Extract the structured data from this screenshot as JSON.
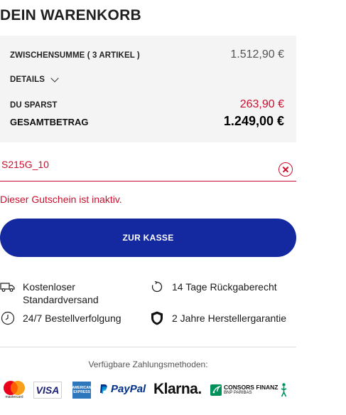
{
  "cart": {
    "title": "DEIN WARENKORB"
  },
  "summary": {
    "subtotal_label": "ZWISCHENSUMME ( 3 ARTIKEL )",
    "subtotal_value": "1.512,90 €",
    "details_label": "DETAILS",
    "savings_label": "DU SPARST",
    "savings_value": "263,90 €",
    "total_label": "GESAMTBETRAG",
    "total_value": "1.249,00 €"
  },
  "coupon": {
    "value": "S215G_10",
    "error": "Dieser Gutschein ist inaktiv."
  },
  "checkout": {
    "button_label": "ZUR KASSE"
  },
  "features": [
    {
      "icon": "truck-icon",
      "text": "Kostenloser Standardversand"
    },
    {
      "icon": "return-icon",
      "text": "14 Tage Rückgaberecht"
    },
    {
      "icon": "clock-icon",
      "text": "24/7 Bestellverfolgung"
    },
    {
      "icon": "shield-icon",
      "text": "2 Jahre Herstellergarantie"
    }
  ],
  "payment": {
    "title": "Verfügbare Zahlungsmethoden:",
    "methods": [
      {
        "icon": "mastercard-logo",
        "text": "mastercard"
      },
      {
        "icon": "visa-logo",
        "text": "VISA"
      },
      {
        "icon": "amex-logo",
        "text": "AMERICAN EXPRESS"
      },
      {
        "icon": "paypal-logo",
        "text": "PayPal"
      },
      {
        "icon": "klarna-logo",
        "text": "Klarna."
      },
      {
        "icon": "consors-logo",
        "text": "CONSORS FINANZ",
        "subtext": "BNP PARIBAS"
      }
    ]
  },
  "colors": {
    "brand_blue": "#1428a0",
    "error_red": "#c8102e",
    "summary_bg": "#f4f4f4"
  }
}
